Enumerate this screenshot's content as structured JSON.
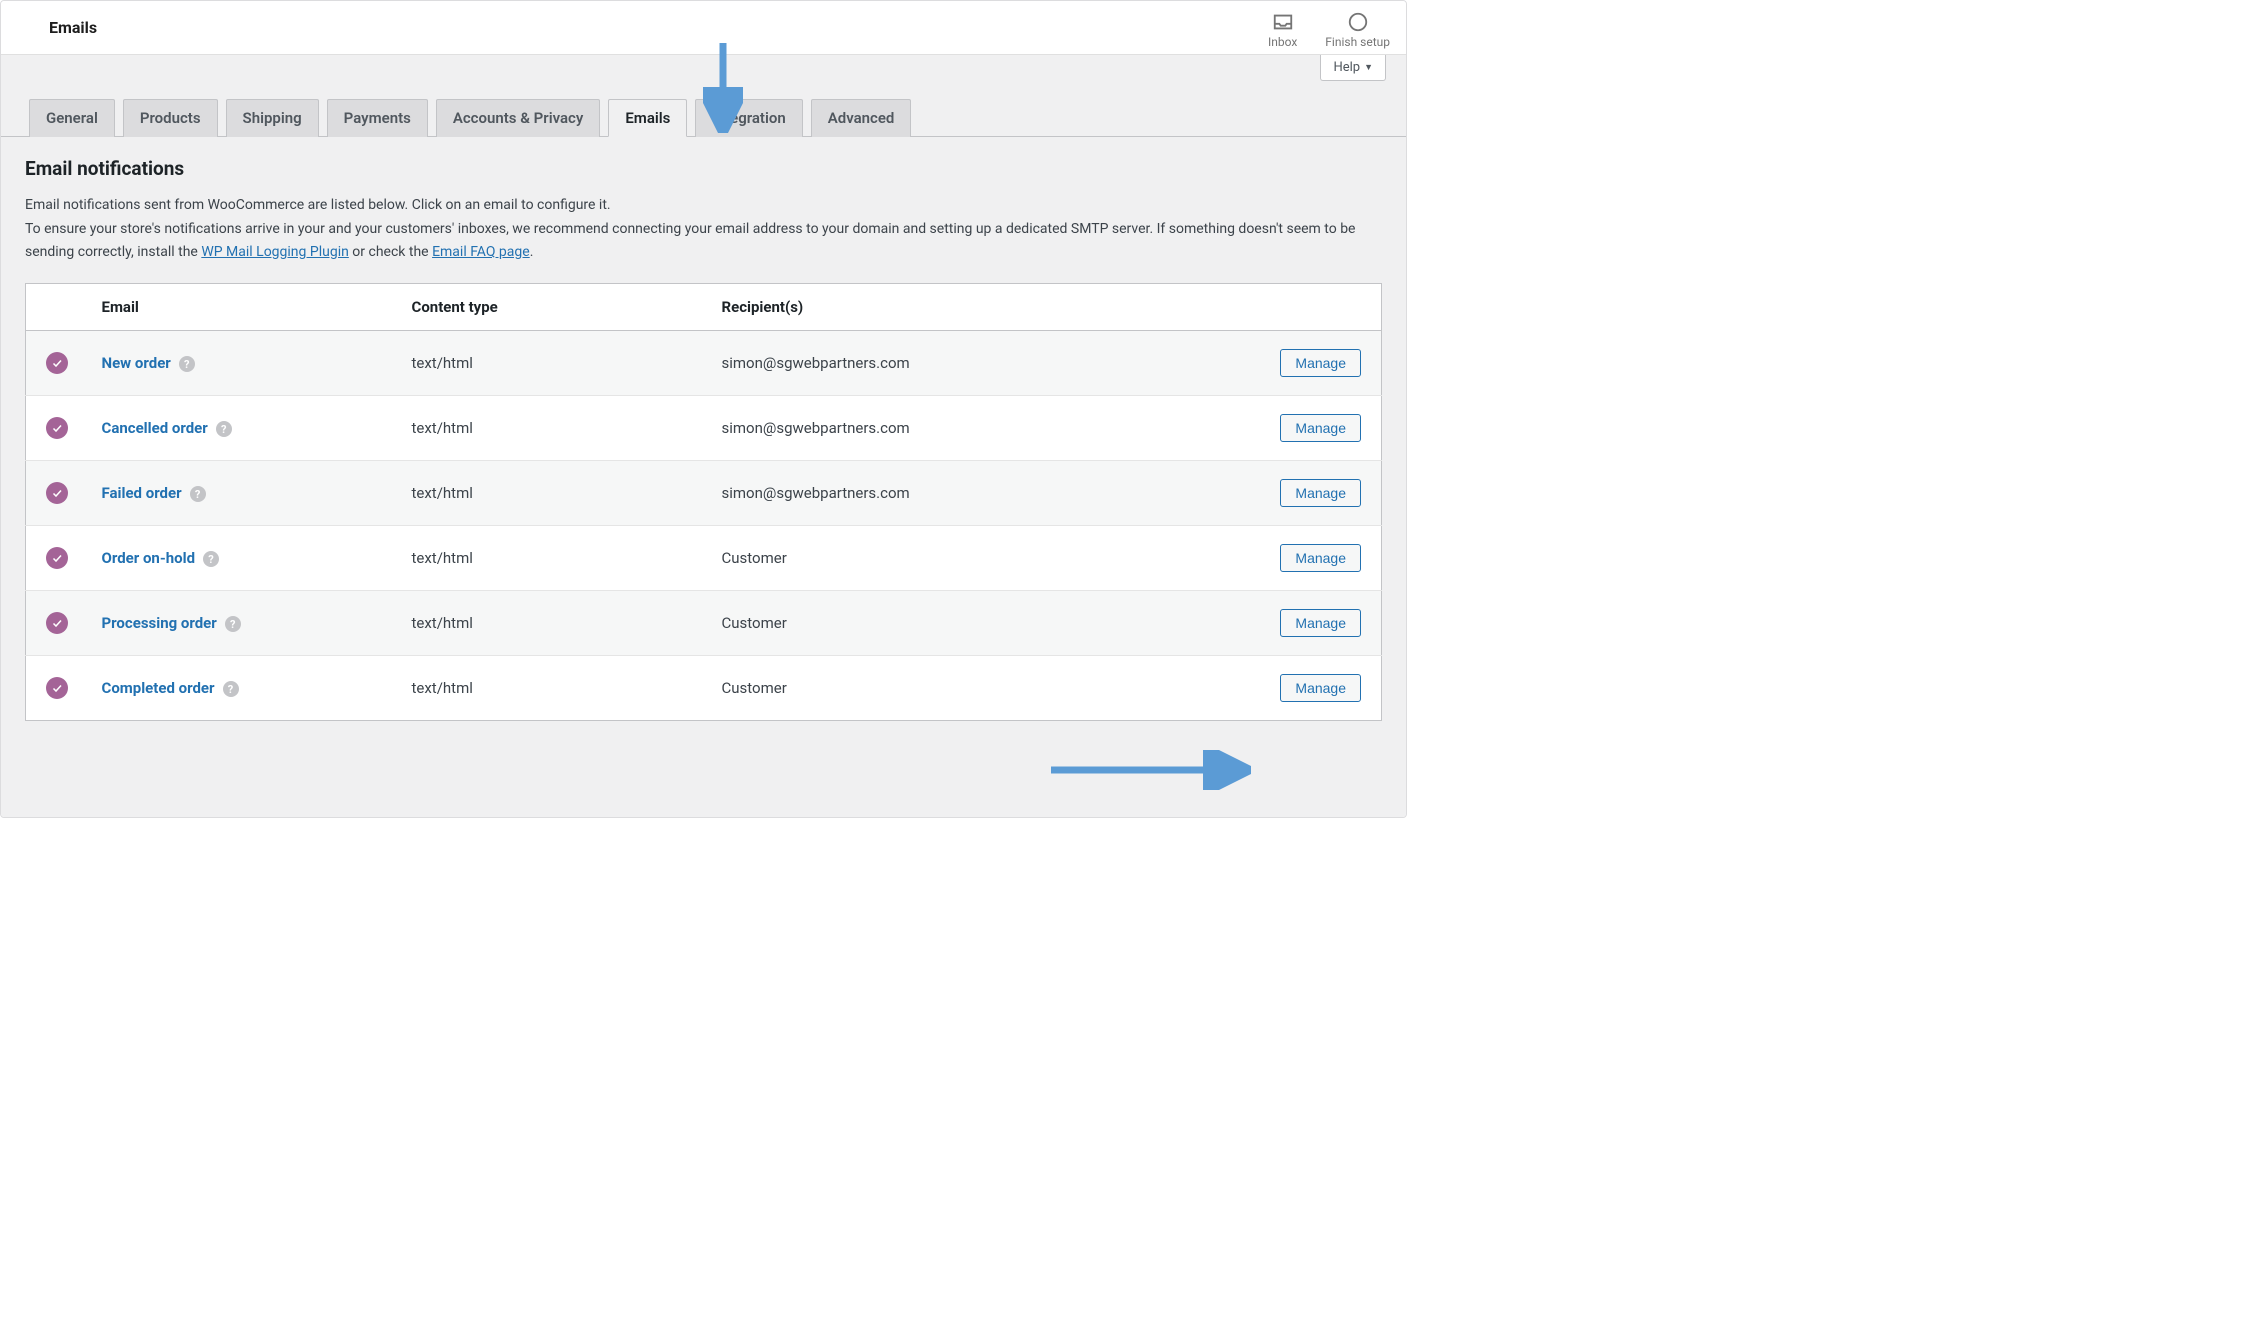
{
  "header": {
    "title": "Emails",
    "inbox_label": "Inbox",
    "finish_label": "Finish setup"
  },
  "help_label": "Help",
  "tabs": {
    "general": "General",
    "products": "Products",
    "shipping": "Shipping",
    "payments": "Payments",
    "accounts": "Accounts & Privacy",
    "emails": "Emails",
    "integration": "Integration",
    "advanced": "Advanced"
  },
  "section": {
    "heading": "Email notifications",
    "line1": "Email notifications sent from WooCommerce are listed below. Click on an email to configure it.",
    "line2a": "To ensure your store's notifications arrive in your and your customers' inboxes, we recommend connecting your email address to your domain and setting up a dedicated SMTP server. If something doesn't seem to be sending correctly, install the ",
    "link1": "WP Mail Logging Plugin",
    "line2b": " or check the ",
    "link2": "Email FAQ page",
    "line2c": "."
  },
  "table": {
    "headers": {
      "email": "Email",
      "content_type": "Content type",
      "recipients": "Recipient(s)"
    },
    "manage_label": "Manage",
    "rows": [
      {
        "name": "New order",
        "content_type": "text/html",
        "recipient": "simon@sgwebpartners.com"
      },
      {
        "name": "Cancelled order",
        "content_type": "text/html",
        "recipient": "simon@sgwebpartners.com"
      },
      {
        "name": "Failed order",
        "content_type": "text/html",
        "recipient": "simon@sgwebpartners.com"
      },
      {
        "name": "Order on-hold",
        "content_type": "text/html",
        "recipient": "Customer"
      },
      {
        "name": "Processing order",
        "content_type": "text/html",
        "recipient": "Customer"
      },
      {
        "name": "Completed order",
        "content_type": "text/html",
        "recipient": "Customer"
      }
    ]
  }
}
